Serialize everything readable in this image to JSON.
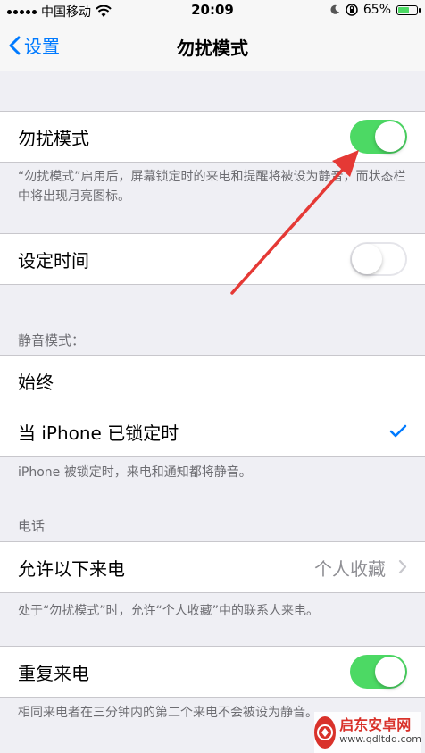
{
  "status": {
    "carrier": "中国移动",
    "time": "20:09",
    "battery": "65%",
    "battery_level": 0.65
  },
  "nav": {
    "back_label": "设置",
    "title": "勿扰模式"
  },
  "dnd": {
    "label": "勿扰模式",
    "enabled": true,
    "footnote": "“勿扰模式”启用后，屏幕锁定时的来电和提醒将被设为静音，而状态栏中将出现月亮图标。"
  },
  "scheduled": {
    "label": "设定时间",
    "enabled": false
  },
  "silence": {
    "header": "静音模式：",
    "options": [
      {
        "label": "始终",
        "selected": false
      },
      {
        "label": "当 iPhone 已锁定时",
        "selected": true
      }
    ],
    "footnote": "iPhone 被锁定时，来电和通知都将静音。"
  },
  "phone": {
    "header": "电话",
    "allow_calls_label": "允许以下来电",
    "allow_calls_value": "个人收藏",
    "allow_footnote": "处于“勿扰模式”时，允许“个人收藏”中的联系人来电。",
    "repeated_label": "重复来电",
    "repeated_enabled": true,
    "repeated_footnote": "相同来电者在三分钟内的第二个来电不会被设为静音。"
  },
  "watermark": {
    "title": "启东安卓网",
    "url": "www.qdltdq.com"
  },
  "colors": {
    "accent": "#007aff",
    "toggle_on": "#4cd964",
    "arrow": "#e53935"
  }
}
